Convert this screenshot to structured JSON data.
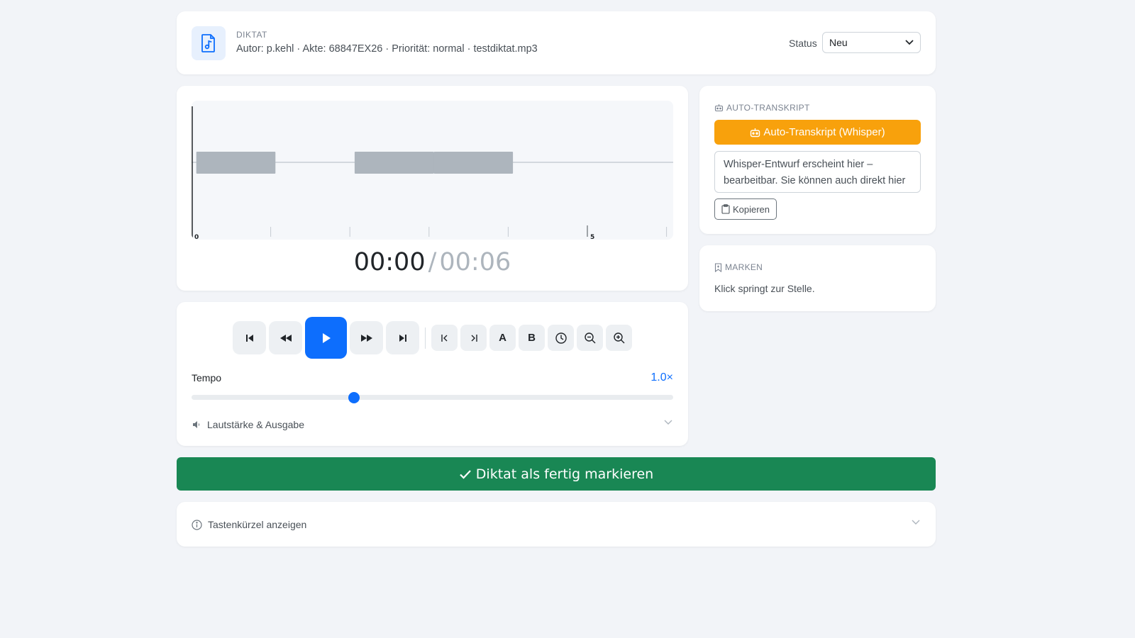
{
  "header": {
    "eyebrow": "DIKTAT",
    "meta": "Autor: p.kehl · Akte: 68847EX26 · Priorität: normal · testdiktat.mp3",
    "status_label": "Status",
    "status_value": "Neu"
  },
  "waveform": {
    "duration_seconds": 6,
    "playhead_seconds": 0,
    "segments": [
      {
        "start": 0.06,
        "end": 1.06
      },
      {
        "start": 2.06,
        "end": 3.06
      },
      {
        "start": 3.06,
        "end": 4.06
      }
    ],
    "tick_labels": [
      "0",
      "5"
    ]
  },
  "time": {
    "current": "00:00",
    "separator": "/",
    "total": "00:06"
  },
  "controls": {
    "marker_a_label": "A",
    "marker_b_label": "B",
    "tempo_label": "Tempo",
    "tempo_value": "1.0×",
    "tempo_fraction": 0.337,
    "volume_label": "Lautstärke & Ausgabe"
  },
  "done_label": "Diktat als fertig markieren",
  "shortcuts_label": "Tastenkürzel anzeigen",
  "transcript": {
    "heading": "AUTO-TRANSKRIPT",
    "button_label": "Auto-Transkript (Whisper)",
    "text": "Whisper-Entwurf erscheint hier – bearbeitbar. Sie können auch direkt hier tippen.",
    "copy_label": "Kopieren"
  },
  "marks": {
    "heading": "MARKEN",
    "hint": "Klick springt zur Stelle."
  },
  "colors": {
    "accent": "#0d6efd",
    "success": "#198754",
    "warning": "#f8a10c",
    "waveform_segment": "#adb5bd"
  }
}
